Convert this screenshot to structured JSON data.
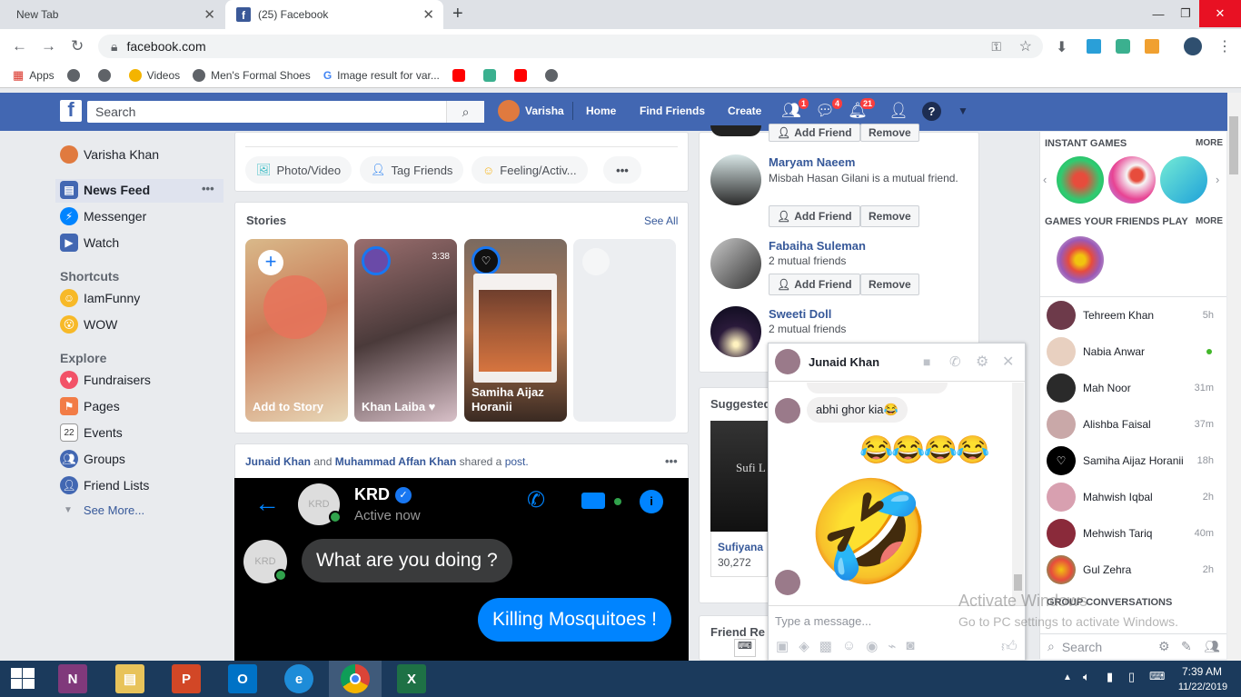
{
  "browser": {
    "tabs": [
      {
        "label": "New Tab"
      },
      {
        "label": "(25) Facebook"
      }
    ],
    "url": "facebook.com",
    "bookmarks": [
      "Apps",
      "Videos",
      "Men's Formal Shoes",
      "Image result for var..."
    ]
  },
  "header": {
    "search_placeholder": "Search",
    "user": "Varisha",
    "nav": [
      "Home",
      "Find Friends",
      "Create"
    ],
    "badges": {
      "friends": "1",
      "messages": "4",
      "notifications": "21"
    }
  },
  "left_nav": {
    "profile": "Varisha Khan",
    "items": [
      "News Feed",
      "Messenger",
      "Watch"
    ],
    "shortcuts_heading": "Shortcuts",
    "shortcuts": [
      "IamFunny",
      "WOW"
    ],
    "explore_heading": "Explore",
    "explore": [
      "Fundraisers",
      "Pages",
      "Events",
      "Groups",
      "Friend Lists"
    ],
    "see_more": "See More..."
  },
  "composer": {
    "actions": [
      "Photo/Video",
      "Tag Friends",
      "Feeling/Activ..."
    ]
  },
  "stories": {
    "heading": "Stories",
    "see_all": "See All",
    "items": [
      {
        "label": "Add to Story"
      },
      {
        "label": "Khan Laiba ♥",
        "time": "3:38"
      },
      {
        "label": "Samiha Aijaz Horanii"
      }
    ]
  },
  "post": {
    "author1": "Junaid Khan",
    "and": "and",
    "author2": "Muhammad Affan Khan",
    "shared": "shared a",
    "post_word": "post.",
    "name": "KRD",
    "status": "Active now",
    "bubble_in": "What are you doing ?",
    "bubble_out": "Killing Mosquitoes !",
    "avatar_text": "KRD"
  },
  "people_you_may_know": [
    {
      "name": "Maryam Naeem",
      "sub": "Misbah Hasan Gilani is a mutual friend.",
      "add": "Add Friend",
      "remove": "Remove"
    },
    {
      "name": "Fabaiha Suleman",
      "sub": "2 mutual friends",
      "add": "Add Friend",
      "remove": "Remove"
    },
    {
      "name": "Sweeti Doll",
      "sub": "2 mutual friends"
    }
  ],
  "top_buttons": {
    "add": "Add Friend",
    "remove": "Remove"
  },
  "suggested": {
    "heading": "Suggested",
    "name": "Sufiyana",
    "count": "30,272",
    "cover": "Sufi L"
  },
  "friend_requests": "Friend Re",
  "right_sidebar": {
    "instant_games": "INSTANT GAMES",
    "more": "MORE",
    "friends_games": "GAMES YOUR FRIENDS PLAY",
    "more2": "MORE",
    "contacts": [
      {
        "name": "Tehreem Khan",
        "time": "5h"
      },
      {
        "name": "Nabia Anwar",
        "time": ""
      },
      {
        "name": "Mah Noor",
        "time": "31m"
      },
      {
        "name": "Alishba Faisal",
        "time": "37m"
      },
      {
        "name": "Samiha Aijaz Horanii",
        "time": "18h"
      },
      {
        "name": "Mahwish Iqbal",
        "time": "2h"
      },
      {
        "name": "Mehwish Tariq",
        "time": "40m"
      },
      {
        "name": "Gul Zehra",
        "time": "2h"
      }
    ],
    "group_conversations": "GROUP CONVERSATIONS",
    "search_placeholder": "Search"
  },
  "chat": {
    "name": "Junaid Khan",
    "message": "abhi ghor kia😂",
    "emojis": "😂😂😂😂",
    "big_emoji": "🤣",
    "input_placeholder": "Type a message..."
  },
  "watermark": {
    "line1": "Activate Windows",
    "line2": "Go to PC settings to activate Windows."
  },
  "taskbar": {
    "time": "7:39 AM",
    "date": "11/22/2019"
  },
  "colors": {
    "fb_blue": "#4267b2",
    "link": "#365899",
    "messenger": "#0084ff"
  }
}
